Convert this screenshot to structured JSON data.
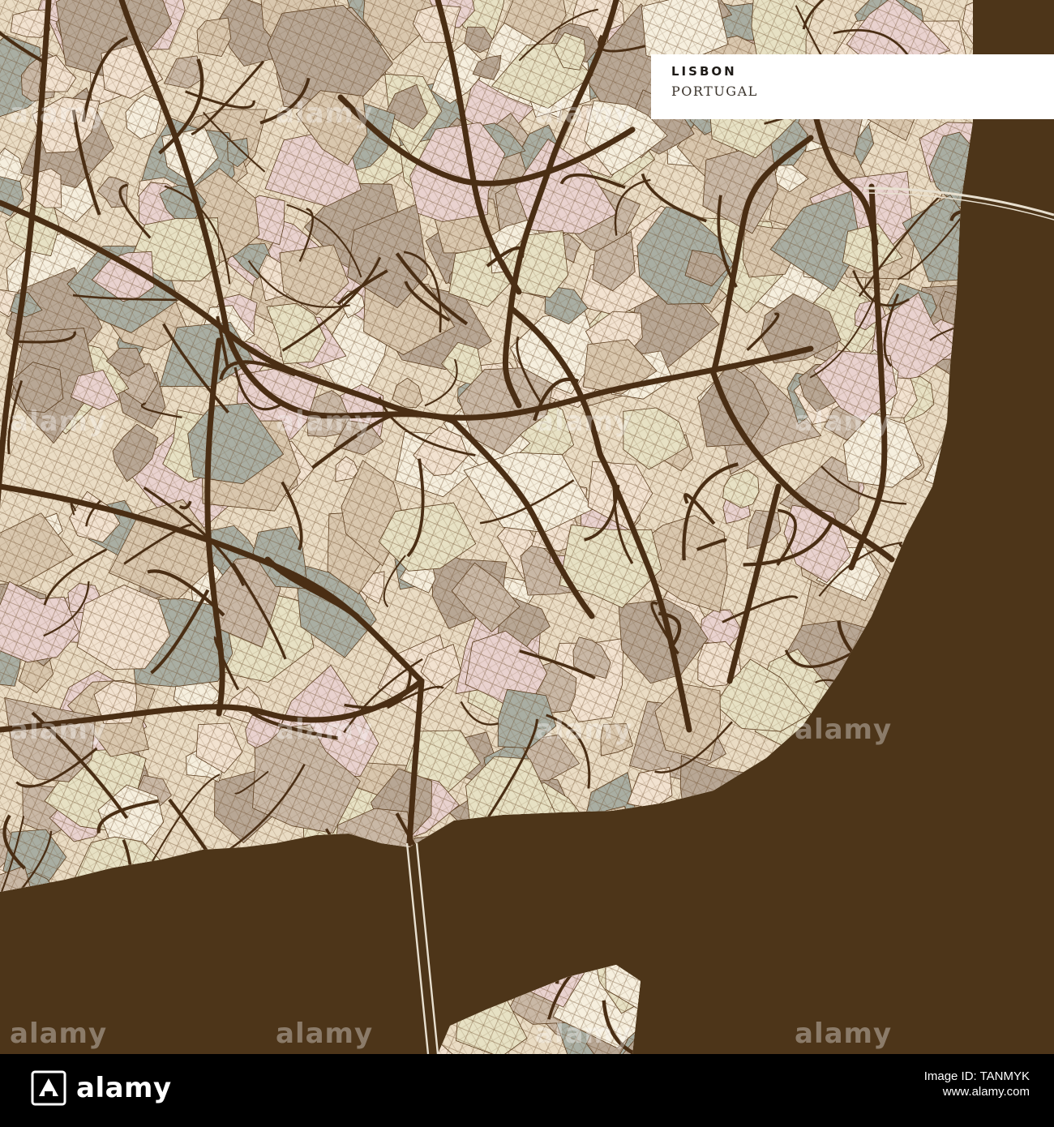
{
  "map": {
    "city": "LISBON",
    "country": "PORTUGAL",
    "colors": {
      "water": "#4d3519",
      "road": "#4a2e14",
      "land_base": "#eadcc4",
      "parcel_palette": [
        "#a9aea3",
        "#c9b8a6",
        "#e9d2cf",
        "#f6efde",
        "#d9c7ae",
        "#e7e1c4",
        "#b8a795",
        "#f2e2d0"
      ]
    }
  },
  "watermark": {
    "text": "alamy"
  },
  "footer": {
    "logo_text": "alamy",
    "image_id_line": "Image ID: TANMYK",
    "site": "www.alamy.com"
  }
}
